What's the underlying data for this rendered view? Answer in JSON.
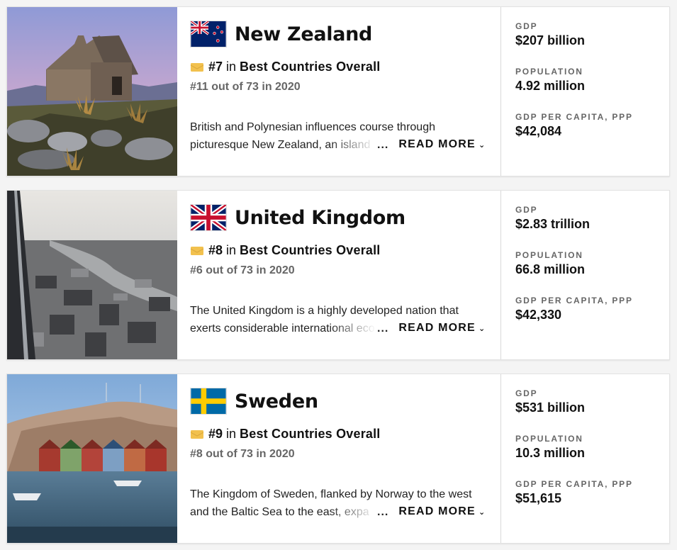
{
  "read_more_label": "READ MORE",
  "in_label": "in",
  "ellipsis": "...",
  "stat_labels": {
    "gdp": "GDP",
    "population": "POPULATION",
    "gdp_pc": "GDP PER CAPITA, PPP"
  },
  "countries": [
    {
      "name": "New Zealand",
      "rank": "#7",
      "category": "Best Countries Overall",
      "previous_rank": "#11 out of 73 in 2020",
      "description_line1": "British and Polynesian influences course through",
      "description_line2": "picturesque New Zealand, an island",
      "gdp": "$207 billion",
      "population": "4.92 million",
      "gdp_per_capita": "$42,084",
      "photo_icon": "stone-church-landscape",
      "flag_icon": "new-zealand-flag"
    },
    {
      "name": "United Kingdom",
      "rank": "#8",
      "category": "Best Countries Overall",
      "previous_rank": "#6 out of 73 in 2020",
      "description_line1": "The United Kingdom is a highly developed nation that",
      "description_line2": "exerts considerable international eco",
      "gdp": "$2.83 trillion",
      "population": "66.8 million",
      "gdp_per_capita": "$42,330",
      "photo_icon": "london-aerial-view",
      "flag_icon": "united-kingdom-flag"
    },
    {
      "name": "Sweden",
      "rank": "#9",
      "category": "Best Countries Overall",
      "previous_rank": "#8 out of 73 in 2020",
      "description_line1": "The Kingdom of Sweden, flanked by Norway to the west",
      "description_line2": "and the Baltic Sea to the east, expa",
      "gdp": "$531 billion",
      "population": "10.3 million",
      "gdp_per_capita": "$51,615",
      "photo_icon": "harbor-boathouses",
      "flag_icon": "sweden-flag"
    }
  ],
  "colors": {
    "badge": "#f2c14e",
    "nz_blue": "#012169",
    "uk_red": "#c8102e",
    "se_blue": "#006aa7",
    "se_yellow": "#fecc02"
  }
}
